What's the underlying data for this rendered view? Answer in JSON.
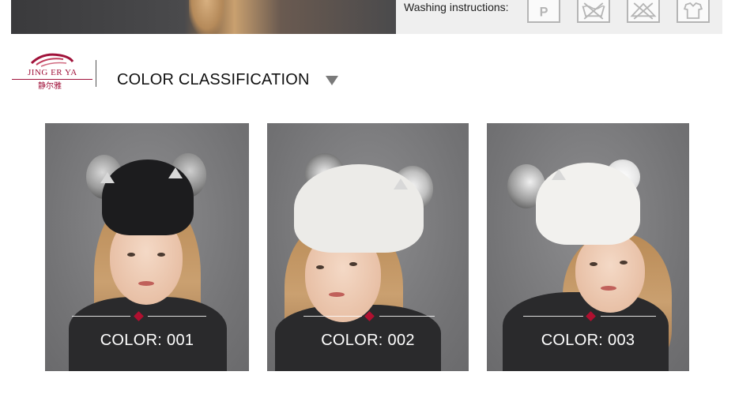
{
  "top": {
    "washing_label": "Washing instructions:",
    "care_icons": [
      "dry-clean-p-icon",
      "no-wash-icon",
      "no-bleach-icon",
      "no-iron-icon"
    ]
  },
  "brand": {
    "name_en": "JING ER YA",
    "name_cn": "静尔雅",
    "color": "#a0123a"
  },
  "section": {
    "title": "COLOR CLASSIFICATION"
  },
  "products": [
    {
      "label": "COLOR: 001",
      "hat_color": "#1c1c1e"
    },
    {
      "label": "COLOR: 002",
      "hat_color": "#ecebe8"
    },
    {
      "label": "COLOR: 003",
      "hat_color": "#f2f1ee"
    }
  ],
  "colors": {
    "accent": "#b01030",
    "card_background": "#7a7a7c"
  }
}
